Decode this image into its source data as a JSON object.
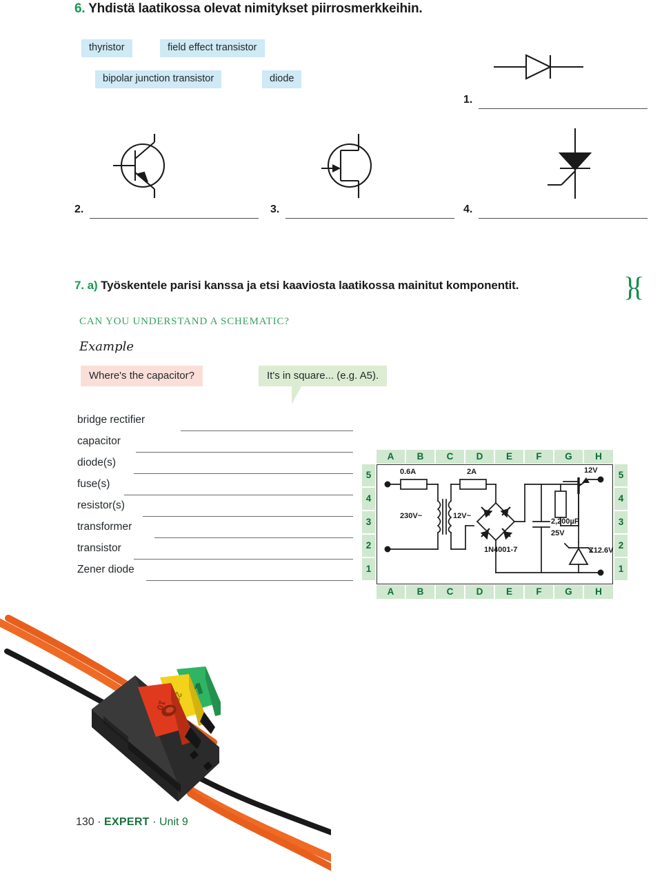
{
  "exercise6": {
    "number": "6.",
    "instruction": "Yhdistä laatikossa olevat nimitykset piirrosmerkkeihin.",
    "chips": [
      {
        "label": "thyristor"
      },
      {
        "label": "field effect transistor"
      },
      {
        "label": "bipolar junction transistor"
      },
      {
        "label": "diode"
      }
    ],
    "chip_color": "#cfe9f5",
    "answers": [
      {
        "index": "1.",
        "symbol": "diode-symbol"
      },
      {
        "index": "2.",
        "symbol": "bipolar-junction-transistor-symbol"
      },
      {
        "index": "3.",
        "symbol": "field-effect-transistor-symbol"
      },
      {
        "index": "4.",
        "symbol": "thyristor-symbol"
      }
    ]
  },
  "exercise7": {
    "number": "7.",
    "part": "a)",
    "instruction": "Työskentele parisi kanssa ja etsi kaaviosta laatikossa mainitut komponentit.",
    "pair_work_icon": "}{",
    "subheading": "CAN YOU UNDERSTAND A SCHEMATIC?",
    "example_label": "Example",
    "question_bubble": "Where's the capacitor?",
    "answer_bubble": "It's in square... (e.g. A5).",
    "question_color": "#fadfd9",
    "answer_color": "#dcecd2",
    "accent_green": "#169a52",
    "checklist": [
      {
        "label": "bridge rectifier"
      },
      {
        "label": "capacitor"
      },
      {
        "label": "diode(s)"
      },
      {
        "label": "fuse(s)"
      },
      {
        "label": "resistor(s)"
      },
      {
        "label": "transformer"
      },
      {
        "label": "transistor"
      },
      {
        "label": "Zener diode"
      }
    ]
  },
  "schematic": {
    "columns": [
      "A",
      "B",
      "C",
      "D",
      "E",
      "F",
      "G",
      "H"
    ],
    "rows": [
      "5",
      "4",
      "3",
      "2",
      "1"
    ],
    "grid_color": "#cfe8cf",
    "grid_text_color": "#0f6b33",
    "labels": [
      {
        "text": "0.6A",
        "name": "fuse-primary-rating"
      },
      {
        "text": "2A",
        "name": "fuse-secondary-rating"
      },
      {
        "text": "230V~",
        "name": "primary-voltage"
      },
      {
        "text": "12V~",
        "name": "secondary-voltage"
      },
      {
        "text": "1N4001-7",
        "name": "bridge-rectifier-part"
      },
      {
        "text": "2,200µF",
        "name": "capacitor-value"
      },
      {
        "text": "25V",
        "name": "capacitor-voltage"
      },
      {
        "text": "Z12.6V",
        "name": "zener-diode-value"
      },
      {
        "text": "12V",
        "name": "output-voltage"
      }
    ]
  },
  "photo": {
    "caption": "fuse-holder-block-with-blade-fuses",
    "fuse_colors": [
      "#e03a1e",
      "#f2d21a",
      "#2fb463"
    ],
    "wire_colors": [
      "#ee6a25",
      "#1a1a1a"
    ],
    "body_color": "#2b2b2b"
  },
  "footer": {
    "page": "130",
    "separator": "·",
    "brand": "EXPERT",
    "unit": "Unit 9"
  }
}
